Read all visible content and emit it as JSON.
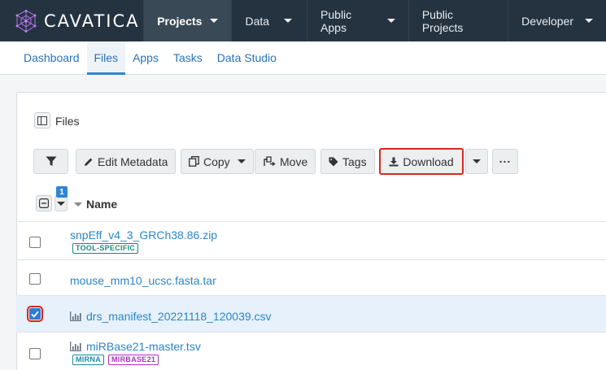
{
  "brand": {
    "name": "CAVATICA"
  },
  "topnav": {
    "items": [
      {
        "label": "Projects",
        "has_caret": true,
        "active": true
      },
      {
        "label": "Data",
        "has_caret": true
      },
      {
        "label": "Public Apps",
        "has_caret": true
      },
      {
        "label": "Public Projects",
        "has_caret": false
      },
      {
        "label": "Developer",
        "has_caret": true
      }
    ]
  },
  "subnav": {
    "items": [
      {
        "label": "Dashboard"
      },
      {
        "label": "Files",
        "active": true
      },
      {
        "label": "Apps"
      },
      {
        "label": "Tasks"
      },
      {
        "label": "Data Studio"
      }
    ]
  },
  "panel": {
    "title": "Files"
  },
  "toolbar": {
    "edit_metadata": "Edit Metadata",
    "copy": "Copy",
    "move": "Move",
    "tags": "Tags",
    "download": "Download",
    "more": "..."
  },
  "table": {
    "selected_count": "1",
    "name_header": "Name",
    "rows": [
      {
        "name": "snpEff_v4_3_GRCh38.86.zip",
        "checked": false,
        "icon": "none",
        "tags": [
          {
            "label": "TOOL-SPECIFIC",
            "color": "#1a8a7d"
          }
        ]
      },
      {
        "name": "mouse_mm10_ucsc.fasta.tar",
        "checked": false,
        "icon": "none",
        "tags": []
      },
      {
        "name": "drs_manifest_20221118_120039.csv",
        "checked": true,
        "icon": "chart-icon",
        "tags": []
      },
      {
        "name": "miRBase21-master.tsv",
        "checked": false,
        "icon": "chart-icon",
        "tags": [
          {
            "label": "MIRNA",
            "color": "#1a8aa8"
          },
          {
            "label": "MIRBASE21",
            "color": "#b02fc4"
          }
        ]
      }
    ]
  },
  "colors": {
    "topnav_bg": "#253341",
    "accent": "#2f86d1",
    "link": "#2a86c9",
    "highlight": "#e0241b"
  }
}
